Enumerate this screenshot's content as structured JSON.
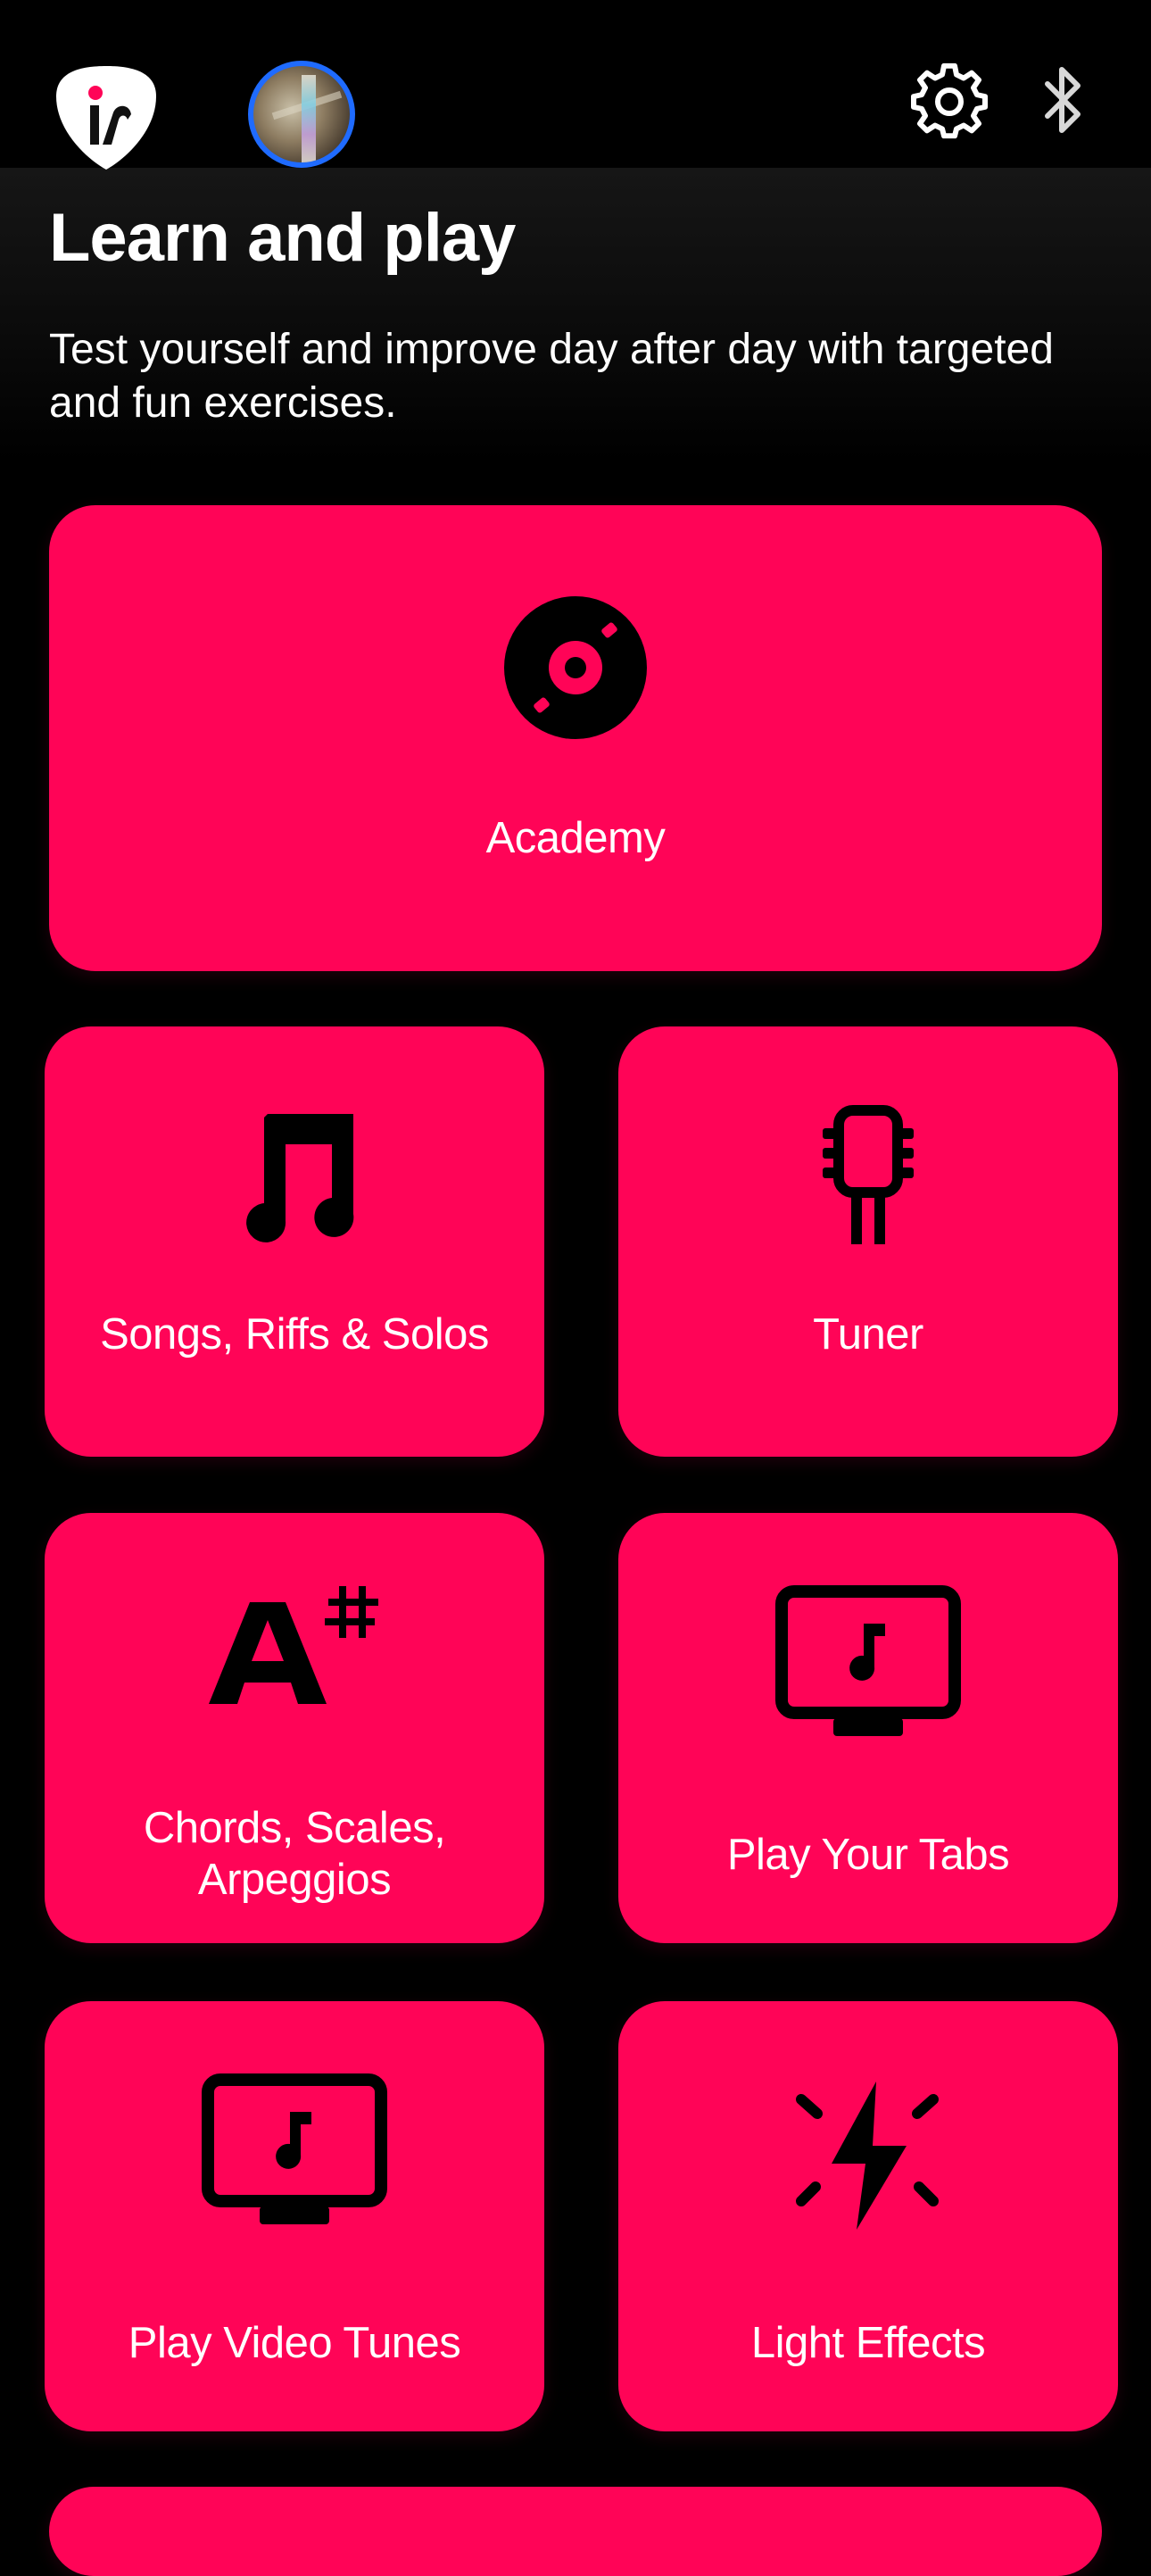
{
  "header": {
    "logo_icon": "tablature-pick-logo-icon",
    "avatar_icon": "profile-avatar",
    "settings_icon": "gear-icon",
    "bluetooth_icon": "bluetooth-icon"
  },
  "hero": {
    "title": "Learn and play",
    "subtitle": "Test yourself and improve day after day with targeted and fun exercises."
  },
  "colors": {
    "background": "#000000",
    "card": "#ff0457",
    "text": "#ffffff",
    "avatar_ring": "#1f6bff"
  },
  "cards": [
    {
      "label": "Academy",
      "icon": "vinyl-record-icon"
    },
    {
      "label": "Songs, Riffs & Solos",
      "icon": "music-note-icon"
    },
    {
      "label": "Tuner",
      "icon": "guitar-headstock-icon"
    },
    {
      "label": "Chords, Scales, Arpeggios",
      "icon": "a-sharp-icon"
    },
    {
      "label": "Play Your Tabs",
      "icon": "monitor-music-icon"
    },
    {
      "label": "Play Video Tunes",
      "icon": "monitor-music-icon"
    },
    {
      "label": "Light Effects",
      "icon": "lightning-bolt-icon"
    }
  ]
}
